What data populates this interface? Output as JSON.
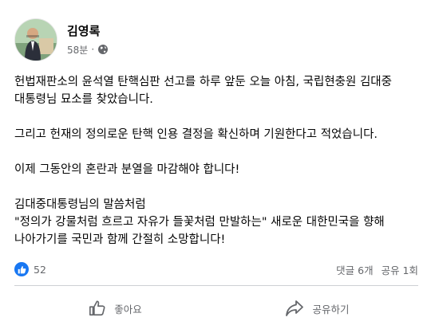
{
  "post": {
    "author": "김영록",
    "time": "58분",
    "separator": "·",
    "icons": {
      "privacy": "globe-icon",
      "like_badge": "thumbs-up-icon"
    },
    "paragraphs": [
      "헌법재판소의 윤석열 탄핵심판 선고를 하루 앞둔 오늘 아침, 국립현충원 김대중\n대통령님 묘소를 찾았습니다.",
      "그리고 헌재의 정의로운 탄핵 인용 결정을 확신하며 기원한다고 적었습니다.",
      "이제 그동안의 혼란과 분열을 마감해야 합니다!",
      "김대중대통령님의 말씀처럼\n\"정의가 강물처럼 흐르고 자유가 들꽃처럼 만발하는\" 새로운 대한민국을 향해\n나아가기를 국민과 함께 간절히 소망합니다!"
    ]
  },
  "stats": {
    "like_count": "52",
    "comments": "댓글 6개",
    "shares": "공유 1회"
  },
  "actions": {
    "like_label": "좋아요",
    "share_label": "공유하기"
  },
  "colors": {
    "accent": "#1877f2",
    "muted": "#65676b"
  }
}
